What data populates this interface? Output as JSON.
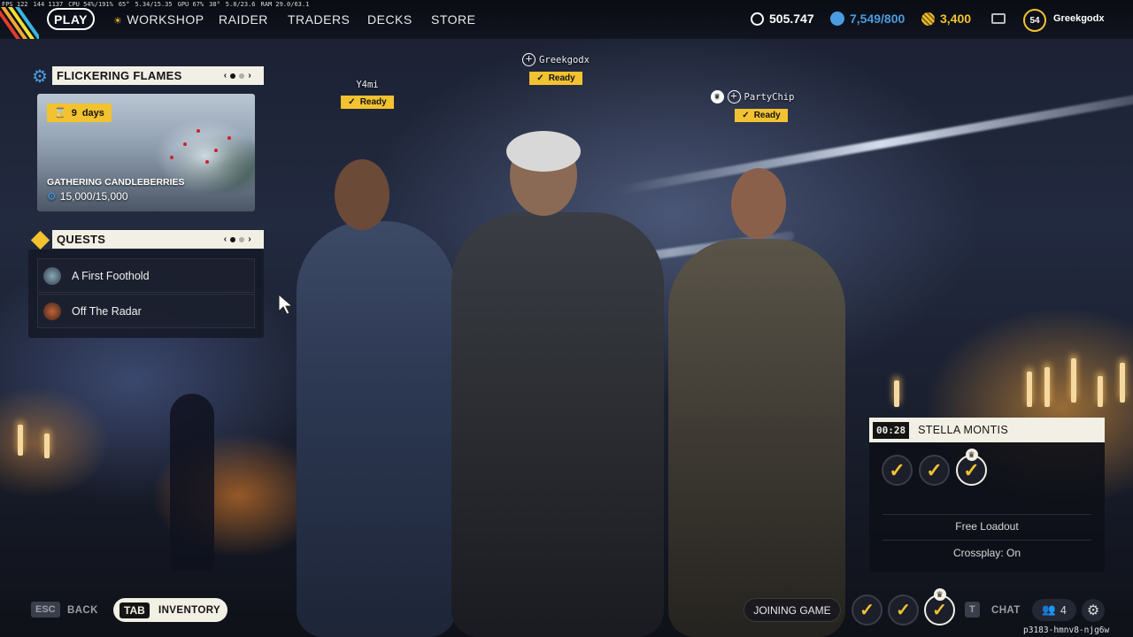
{
  "perf": {
    "fps": "FPS 122",
    "frame": "144 1137",
    "cpu": "CPU 54%/191%",
    "temp1": "65°",
    "mem": "5.34/15.35",
    "gpu": "GPU 67%",
    "temp2": "38°",
    "vram": "5.8/23.6",
    "ram": "RAM 29.0/63.1"
  },
  "nav": {
    "play": "PLAY",
    "items": [
      {
        "label": "WORKSHOP",
        "icon": "sun-icon"
      },
      {
        "label": "RAIDER"
      },
      {
        "label": "TRADERS"
      },
      {
        "label": "DECKS"
      },
      {
        "label": "STORE"
      }
    ]
  },
  "currencies": [
    {
      "value": "505.747",
      "icon": "coin-icon",
      "color": "#ffffff"
    },
    {
      "value": "7,549/800",
      "icon": "token-icon",
      "color": "#4a9ce0"
    },
    {
      "value": "3,400",
      "icon": "raider-coin-icon",
      "color": "#f2c230"
    }
  ],
  "player": {
    "level": "54",
    "name": "Greekgodx"
  },
  "event": {
    "title": "FLICKERING FLAMES",
    "days_num": "9",
    "days_label": "days",
    "name": "GATHERING CANDLEBERRIES",
    "progress": "15,000/15,000"
  },
  "quests": {
    "title": "QUESTS",
    "items": [
      {
        "label": "A First Foothold"
      },
      {
        "label": "Off The Radar"
      }
    ]
  },
  "party": [
    {
      "name": "Y4mi",
      "status": "Ready"
    },
    {
      "name": "Greekgodx",
      "status": "Ready"
    },
    {
      "name": "PartyChip",
      "status": "Ready"
    }
  ],
  "lobby": {
    "timer": "00:28",
    "map": "STELLA MONTIS",
    "loadout": "Free Loadout",
    "crossplay": "Crossplay: On"
  },
  "bottom": {
    "esc_key": "ESC",
    "back": "BACK",
    "tab_key": "TAB",
    "inventory": "INVENTORY",
    "joining": "JOINING GAME",
    "chat_key": "T",
    "chat": "CHAT",
    "party_count": "4",
    "session_id": "p3183-hmnv8-njg6w"
  },
  "colors": {
    "accent": "#f2c230",
    "panel_light": "#f2efe4",
    "token_blue": "#4a9ce0"
  }
}
